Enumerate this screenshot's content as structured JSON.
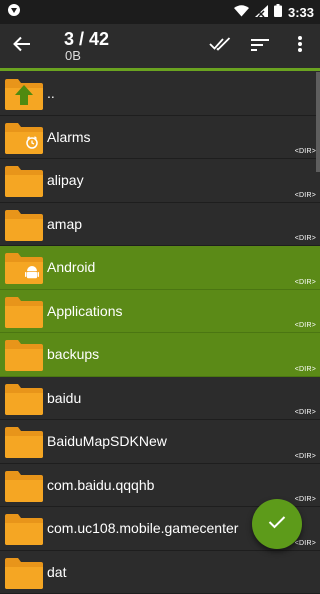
{
  "status": {
    "time": "3:33"
  },
  "header": {
    "title": "3 / 42",
    "subtitle": "0B"
  },
  "rows": [
    {
      "name": "..",
      "tag": "",
      "selected": false,
      "badge": "up-arrow-icon"
    },
    {
      "name": "Alarms",
      "tag": "<DIR>",
      "selected": false,
      "badge": "alarm-clock-icon"
    },
    {
      "name": "alipay",
      "tag": "<DIR>",
      "selected": false,
      "badge": ""
    },
    {
      "name": "amap",
      "tag": "<DIR>",
      "selected": false,
      "badge": ""
    },
    {
      "name": "Android",
      "tag": "<DIR>",
      "selected": true,
      "badge": "android-icon"
    },
    {
      "name": "Applications",
      "tag": "<DIR>",
      "selected": true,
      "badge": ""
    },
    {
      "name": "backups",
      "tag": "<DIR>",
      "selected": true,
      "badge": ""
    },
    {
      "name": "baidu",
      "tag": "<DIR>",
      "selected": false,
      "badge": ""
    },
    {
      "name": "BaiduMapSDKNew",
      "tag": "<DIR>",
      "selected": false,
      "badge": ""
    },
    {
      "name": "com.baidu.qqqhb",
      "tag": "<DIR>",
      "selected": false,
      "badge": ""
    },
    {
      "name": "com.uc108.mobile.gamecenter",
      "tag": "<DIR>",
      "selected": false,
      "badge": ""
    },
    {
      "name": "dat",
      "tag": "",
      "selected": false,
      "badge": ""
    }
  ],
  "colors": {
    "accent": "#6aa320",
    "selected_bg": "#5b8a17",
    "folder": "#f5a623",
    "background": "#2c2c2c"
  }
}
